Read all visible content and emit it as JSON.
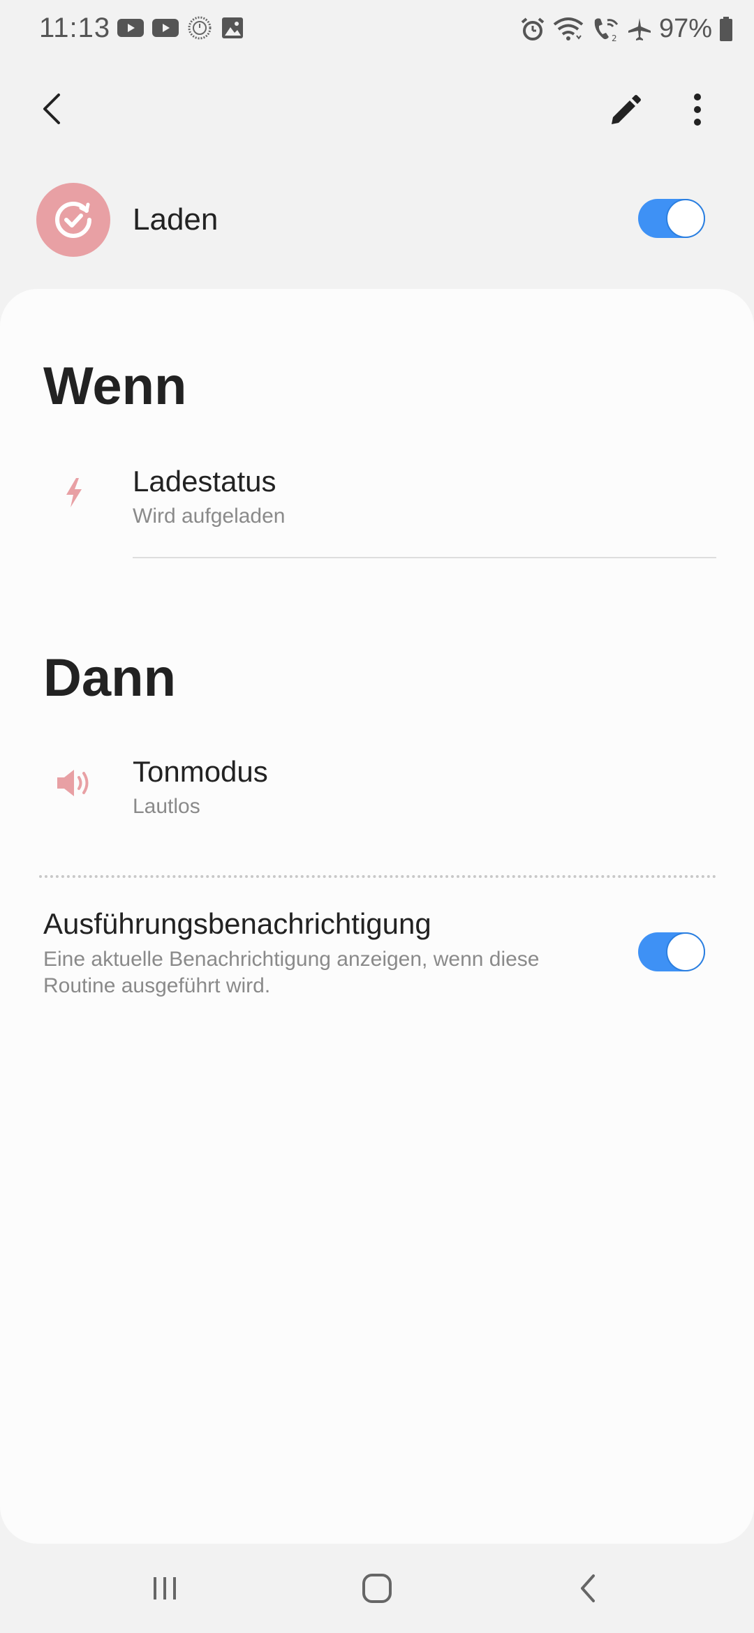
{
  "status_bar": {
    "time": "11:13",
    "battery": "97%",
    "left_icons": [
      "youtube-icon",
      "youtube-icon",
      "clock-app-icon",
      "gallery-icon"
    ],
    "right_icons": [
      "alarm-icon",
      "wifi-icon",
      "wifi-call-icon",
      "airplane-icon",
      "battery-icon"
    ]
  },
  "app_bar": {
    "back_icon": "back-arrow-icon",
    "edit_icon": "pencil-icon",
    "more_icon": "more-vert-icon"
  },
  "routine": {
    "name": "Laden",
    "icon": "routine-check-icon",
    "icon_color": "#e8a0a4",
    "enabled": true
  },
  "conditions": {
    "title": "Wenn",
    "items": [
      {
        "title": "Ladestatus",
        "subtitle": "Wird aufgeladen",
        "icon": "charging-bolt-icon"
      }
    ]
  },
  "actions": {
    "title": "Dann",
    "items": [
      {
        "title": "Tonmodus",
        "subtitle": "Lautlos",
        "icon": "speaker-icon"
      }
    ]
  },
  "notification": {
    "title": "Ausführungsbenachrichtigung",
    "description": "Eine aktuelle Benachrichtigung anzeigen, wenn diese Routine ausgeführt wird.",
    "enabled": true
  },
  "nav_bar": {
    "recents_icon": "recents-icon",
    "home_icon": "home-icon",
    "back_icon": "nav-back-icon"
  },
  "colors": {
    "accent": "#3e91f5",
    "icon_pink": "#e8a0a4",
    "background": "#f2f2f2",
    "card": "#fcfcfc"
  }
}
